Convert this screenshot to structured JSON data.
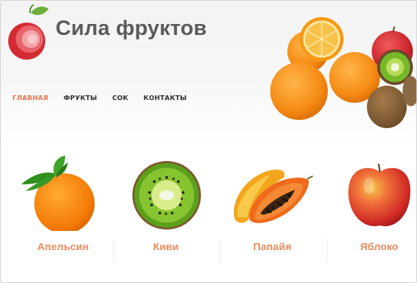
{
  "site": {
    "title": "Сила фруктов"
  },
  "nav": {
    "items": [
      {
        "label": "ГЛАВНАЯ",
        "active": true
      },
      {
        "label": "ФРУКТЫ",
        "active": false
      },
      {
        "label": "СОК",
        "active": false
      },
      {
        "label": "КОНТАКТЫ",
        "active": false
      }
    ]
  },
  "products": [
    {
      "label": "Апельсин",
      "image": "orange-image"
    },
    {
      "label": "Киви",
      "image": "kiwi-image"
    },
    {
      "label": "Папайя",
      "image": "papaya-image"
    },
    {
      "label": "Яблоко",
      "image": "apple-image"
    }
  ],
  "colors": {
    "accent": "#e8744a",
    "product_label": "#ec8a5c",
    "title": "#5b5b5b"
  }
}
